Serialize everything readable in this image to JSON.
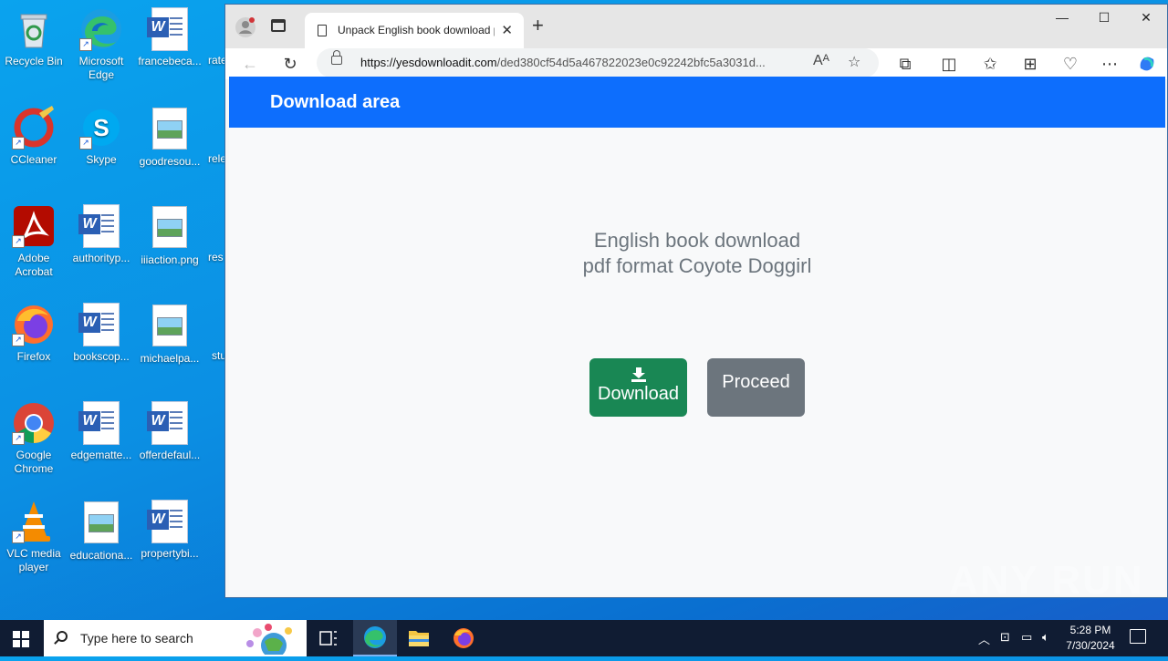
{
  "desktop": {
    "icons": [
      {
        "label": "Recycle Bin"
      },
      {
        "label": "Microsoft Edge"
      },
      {
        "label": "francebeca..."
      },
      {
        "label": "CCleaner"
      },
      {
        "label": "Skype"
      },
      {
        "label": "goodresou..."
      },
      {
        "label": "Adobe Acrobat"
      },
      {
        "label": "authorityp..."
      },
      {
        "label": "iiiaction.png"
      },
      {
        "label": "Firefox"
      },
      {
        "label": "bookscop..."
      },
      {
        "label": "michaelpa..."
      },
      {
        "label": "Google Chrome"
      },
      {
        "label": "edgematte..."
      },
      {
        "label": "offerdefaul..."
      },
      {
        "label": "VLC media player"
      },
      {
        "label": "educationa..."
      },
      {
        "label": "propertybi..."
      }
    ],
    "partial_labels": [
      "rate",
      "rele",
      "res",
      "stu"
    ]
  },
  "browser": {
    "tab_title": "Unpack English book download pdf format Coyote Doggirl",
    "url_domain": "https://yesdownloadit.com",
    "url_path": "/ded380cf54d5a467822023e0c92242bfc5a3031d...",
    "read_aloud_icon": "Aᴬ"
  },
  "page": {
    "brand": "Download area",
    "book_title": "English book download pdf format Coyote Doggirl",
    "download_label": "Download",
    "proceed_label": "Proceed"
  },
  "watermark": "ANY RUN",
  "taskbar": {
    "search_placeholder": "Type here to search",
    "time": "5:28 PM",
    "date": "7/30/2024"
  }
}
